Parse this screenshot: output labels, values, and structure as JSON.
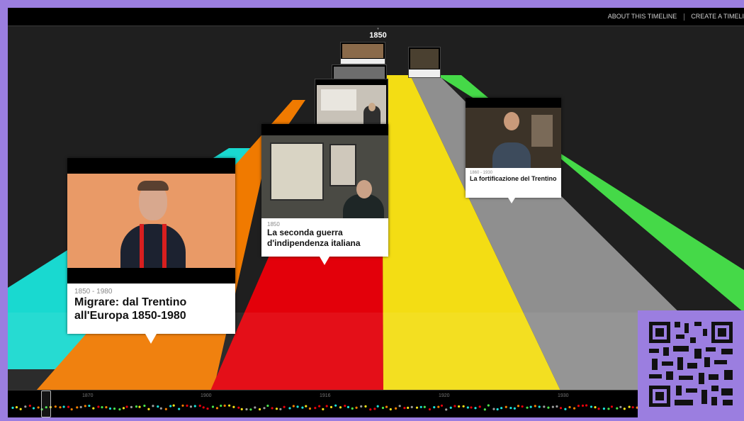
{
  "header": {
    "links": [
      "ABOUT THIS TIMELINE",
      "CREATE A TIMELI"
    ]
  },
  "current_year": "1850",
  "lane_colors": [
    "#19e3da",
    "#f47f00",
    "#e8000b",
    "#f6e117",
    "#9c9c9c",
    "#48e34a"
  ],
  "cards": [
    {
      "date": "1850 - 1980",
      "title": "Migrare: dal Trentino all'Europa 1850-1980",
      "thumb_icon": "video-thumbnail-icon"
    },
    {
      "date": "1850",
      "title": "La seconda guerra d'indipendenza italiana",
      "thumb_icon": "video-thumbnail-icon"
    },
    {
      "date": "1860 - 1930",
      "title": "La fortificazione del Trentino",
      "thumb_icon": "video-thumbnail-icon"
    }
  ],
  "scrubber": {
    "ticks": [
      "1870",
      "1900",
      "1916",
      "1920",
      "1930"
    ]
  }
}
